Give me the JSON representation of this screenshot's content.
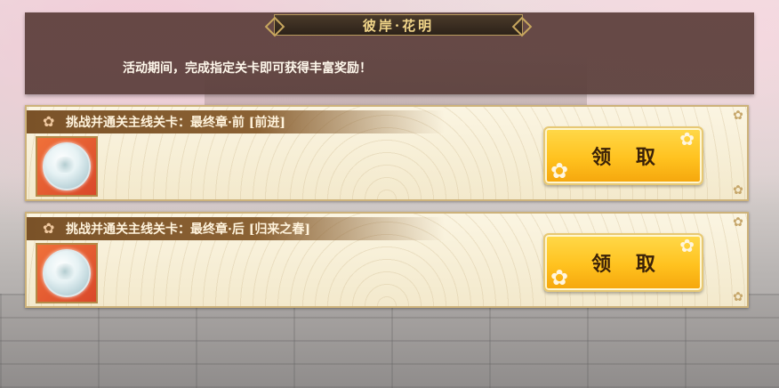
{
  "header": {
    "title": "彼岸·花明",
    "intro": "活动期间，完成指定关卡即可获得丰富奖励！"
  },
  "tasks": [
    {
      "title": "挑战并通关主线关卡：最终章·前 [前进]",
      "claim_label": "领 取",
      "reward_icon": "silver-orb-icon"
    },
    {
      "title": "挑战并通关主线关卡：最终章·后 [归来之春]",
      "claim_label": "领 取",
      "reward_icon": "silver-orb-icon"
    }
  ],
  "colors": {
    "header_bg": "#5c3e3a",
    "title_text": "#f2d68a",
    "card_bg": "#fbf5e2",
    "title_bar": "#7a5228",
    "button_gold": "#ffc21f",
    "reward_bg": "#f0713a"
  }
}
